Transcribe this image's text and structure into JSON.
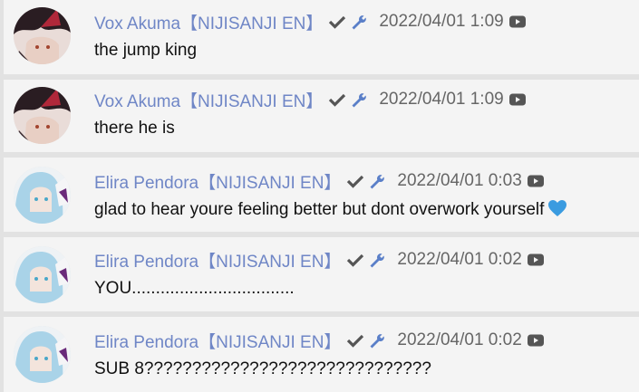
{
  "messages": [
    {
      "author": "Vox Akuma【NIJISANJI EN】",
      "timestamp": "2022/04/01 1:09",
      "text": "the jump king",
      "avatar": "vox"
    },
    {
      "author": "Vox Akuma【NIJISANJI EN】",
      "timestamp": "2022/04/01 1:09",
      "text": "there he is",
      "avatar": "vox"
    },
    {
      "author": "Elira Pendora【NIJISANJI EN】",
      "timestamp": "2022/04/01 0:03",
      "text": "glad to hear youre feeling better but dont overwork yourself",
      "emoji": "blue-heart-icon",
      "avatar": "elira"
    },
    {
      "author": "Elira Pendora【NIJISANJI EN】",
      "timestamp": "2022/04/01 0:02",
      "text": "YOU..................................",
      "avatar": "elira"
    },
    {
      "author": "Elira Pendora【NIJISANJI EN】",
      "timestamp": "2022/04/01 0:02",
      "text": "SUB 8??????????????????????????????",
      "avatar": "elira"
    }
  ],
  "colors": {
    "author": "#6f86c6",
    "icon": "#555555",
    "heart": "#3a9be0",
    "row_bg": "#f4f4f4",
    "gap_bg": "#e2e2e2"
  }
}
